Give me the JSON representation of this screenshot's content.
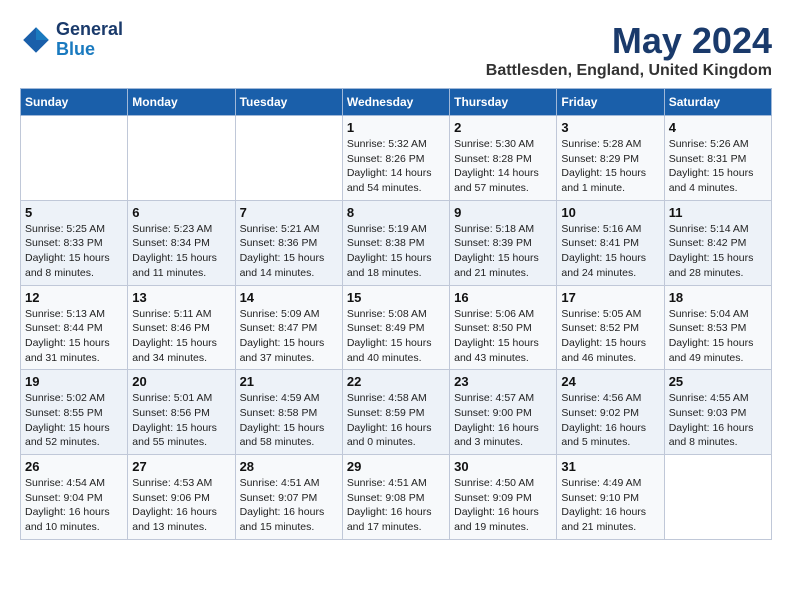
{
  "logo": {
    "line1": "General",
    "line2": "Blue"
  },
  "title": "May 2024",
  "subtitle": "Battlesden, England, United Kingdom",
  "days_of_week": [
    "Sunday",
    "Monday",
    "Tuesday",
    "Wednesday",
    "Thursday",
    "Friday",
    "Saturday"
  ],
  "weeks": [
    [
      {
        "day": "",
        "info": ""
      },
      {
        "day": "",
        "info": ""
      },
      {
        "day": "",
        "info": ""
      },
      {
        "day": "1",
        "info": "Sunrise: 5:32 AM\nSunset: 8:26 PM\nDaylight: 14 hours and 54 minutes."
      },
      {
        "day": "2",
        "info": "Sunrise: 5:30 AM\nSunset: 8:28 PM\nDaylight: 14 hours and 57 minutes."
      },
      {
        "day": "3",
        "info": "Sunrise: 5:28 AM\nSunset: 8:29 PM\nDaylight: 15 hours and 1 minute."
      },
      {
        "day": "4",
        "info": "Sunrise: 5:26 AM\nSunset: 8:31 PM\nDaylight: 15 hours and 4 minutes."
      }
    ],
    [
      {
        "day": "5",
        "info": "Sunrise: 5:25 AM\nSunset: 8:33 PM\nDaylight: 15 hours and 8 minutes."
      },
      {
        "day": "6",
        "info": "Sunrise: 5:23 AM\nSunset: 8:34 PM\nDaylight: 15 hours and 11 minutes."
      },
      {
        "day": "7",
        "info": "Sunrise: 5:21 AM\nSunset: 8:36 PM\nDaylight: 15 hours and 14 minutes."
      },
      {
        "day": "8",
        "info": "Sunrise: 5:19 AM\nSunset: 8:38 PM\nDaylight: 15 hours and 18 minutes."
      },
      {
        "day": "9",
        "info": "Sunrise: 5:18 AM\nSunset: 8:39 PM\nDaylight: 15 hours and 21 minutes."
      },
      {
        "day": "10",
        "info": "Sunrise: 5:16 AM\nSunset: 8:41 PM\nDaylight: 15 hours and 24 minutes."
      },
      {
        "day": "11",
        "info": "Sunrise: 5:14 AM\nSunset: 8:42 PM\nDaylight: 15 hours and 28 minutes."
      }
    ],
    [
      {
        "day": "12",
        "info": "Sunrise: 5:13 AM\nSunset: 8:44 PM\nDaylight: 15 hours and 31 minutes."
      },
      {
        "day": "13",
        "info": "Sunrise: 5:11 AM\nSunset: 8:46 PM\nDaylight: 15 hours and 34 minutes."
      },
      {
        "day": "14",
        "info": "Sunrise: 5:09 AM\nSunset: 8:47 PM\nDaylight: 15 hours and 37 minutes."
      },
      {
        "day": "15",
        "info": "Sunrise: 5:08 AM\nSunset: 8:49 PM\nDaylight: 15 hours and 40 minutes."
      },
      {
        "day": "16",
        "info": "Sunrise: 5:06 AM\nSunset: 8:50 PM\nDaylight: 15 hours and 43 minutes."
      },
      {
        "day": "17",
        "info": "Sunrise: 5:05 AM\nSunset: 8:52 PM\nDaylight: 15 hours and 46 minutes."
      },
      {
        "day": "18",
        "info": "Sunrise: 5:04 AM\nSunset: 8:53 PM\nDaylight: 15 hours and 49 minutes."
      }
    ],
    [
      {
        "day": "19",
        "info": "Sunrise: 5:02 AM\nSunset: 8:55 PM\nDaylight: 15 hours and 52 minutes."
      },
      {
        "day": "20",
        "info": "Sunrise: 5:01 AM\nSunset: 8:56 PM\nDaylight: 15 hours and 55 minutes."
      },
      {
        "day": "21",
        "info": "Sunrise: 4:59 AM\nSunset: 8:58 PM\nDaylight: 15 hours and 58 minutes."
      },
      {
        "day": "22",
        "info": "Sunrise: 4:58 AM\nSunset: 8:59 PM\nDaylight: 16 hours and 0 minutes."
      },
      {
        "day": "23",
        "info": "Sunrise: 4:57 AM\nSunset: 9:00 PM\nDaylight: 16 hours and 3 minutes."
      },
      {
        "day": "24",
        "info": "Sunrise: 4:56 AM\nSunset: 9:02 PM\nDaylight: 16 hours and 5 minutes."
      },
      {
        "day": "25",
        "info": "Sunrise: 4:55 AM\nSunset: 9:03 PM\nDaylight: 16 hours and 8 minutes."
      }
    ],
    [
      {
        "day": "26",
        "info": "Sunrise: 4:54 AM\nSunset: 9:04 PM\nDaylight: 16 hours and 10 minutes."
      },
      {
        "day": "27",
        "info": "Sunrise: 4:53 AM\nSunset: 9:06 PM\nDaylight: 16 hours and 13 minutes."
      },
      {
        "day": "28",
        "info": "Sunrise: 4:51 AM\nSunset: 9:07 PM\nDaylight: 16 hours and 15 minutes."
      },
      {
        "day": "29",
        "info": "Sunrise: 4:51 AM\nSunset: 9:08 PM\nDaylight: 16 hours and 17 minutes."
      },
      {
        "day": "30",
        "info": "Sunrise: 4:50 AM\nSunset: 9:09 PM\nDaylight: 16 hours and 19 minutes."
      },
      {
        "day": "31",
        "info": "Sunrise: 4:49 AM\nSunset: 9:10 PM\nDaylight: 16 hours and 21 minutes."
      },
      {
        "day": "",
        "info": ""
      }
    ]
  ]
}
